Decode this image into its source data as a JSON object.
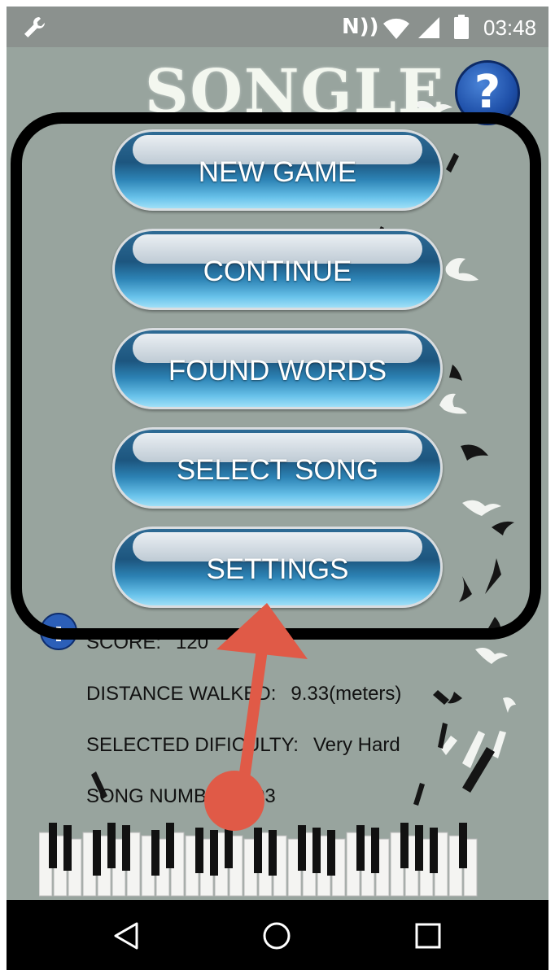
{
  "status_bar": {
    "nfc": "N))",
    "time": "03:48",
    "icons": [
      "wrench-icon",
      "nfc-icon",
      "wifi-icon",
      "signal-icon",
      "battery-icon"
    ]
  },
  "app": {
    "logo": "SONGLE",
    "help_label": "?",
    "menu": [
      {
        "label": "NEW GAME"
      },
      {
        "label": "CONTINUE"
      },
      {
        "label": "FOUND WORDS"
      },
      {
        "label": "SELECT SONG"
      },
      {
        "label": "SETTINGS"
      }
    ],
    "stats": {
      "score_label": "SCORE:",
      "score_value": "120",
      "distance_label": "DISTANCE WALKED:",
      "distance_value": "9.33(meters)",
      "difficulty_label": "SELECTED DIFICULTY:",
      "difficulty_value": "Very Hard",
      "song_label": "SONG NUMBER:",
      "song_value": "03"
    }
  },
  "nav_bar": {
    "icons": [
      "back-icon",
      "home-icon",
      "recents-icon"
    ]
  },
  "annotation_colors": {
    "highlight_box": "#000000",
    "arrow": "#e05a47"
  },
  "colors": {
    "background": "#98a49e",
    "button_top": "#1d567f",
    "button_bottom": "#9fe0f7"
  }
}
